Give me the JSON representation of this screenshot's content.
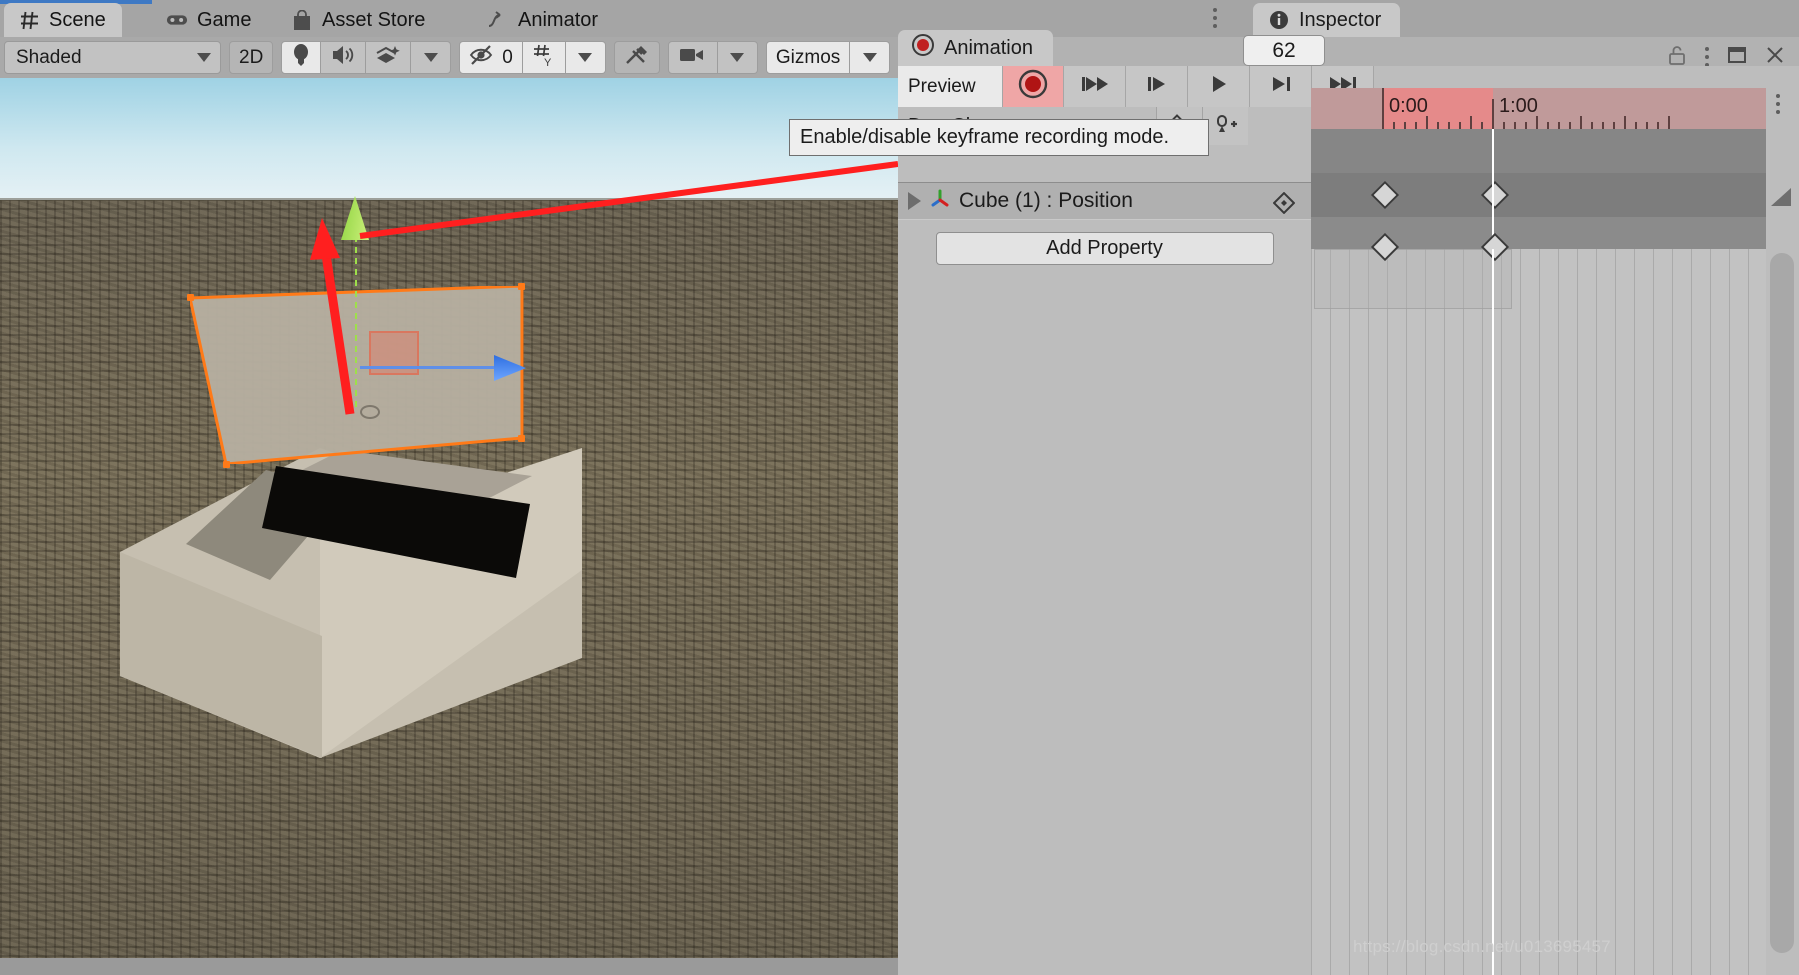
{
  "window": {
    "tabs": [
      {
        "label": "Scene",
        "icon": "grid-icon",
        "active": true
      },
      {
        "label": "Game",
        "icon": "gamepad-icon",
        "active": false
      },
      {
        "label": "Asset Store",
        "icon": "store-bag-icon",
        "active": false
      },
      {
        "label": "Animator",
        "icon": "animator-icon",
        "active": false
      }
    ],
    "inspector_tab": {
      "label": "Inspector",
      "icon": "info-icon"
    },
    "controls": {
      "lock": "lock-open-icon",
      "menu": "kebab-menu-icon",
      "maximize": "maximize-icon",
      "close": "close-icon"
    }
  },
  "scene_toolbar": {
    "draw_mode": "Shaded",
    "two_d": "2D",
    "lighting_icon": "lightbulb-icon",
    "audio_icon": "speaker-icon",
    "fx_icon": "effects-icon",
    "hidden_count": "0",
    "hidden_icon": "eye-off-icon",
    "grid_icon": "grid-snap-icon",
    "tools_icon": "tools-icon",
    "camera_icon": "camera-icon",
    "gizmos": "Gizmos"
  },
  "animation": {
    "tab_label": "Animation",
    "tab_icon": "record-circle-icon",
    "preview_label": "Preview",
    "record_icon": "record-button-icon",
    "transport": [
      {
        "name": "first-frame-button",
        "icon": "skip-start-icon"
      },
      {
        "name": "prev-keyframe-button",
        "icon": "step-back-icon"
      },
      {
        "name": "play-button",
        "icon": "play-icon"
      },
      {
        "name": "next-keyframe-button",
        "icon": "step-forward-icon"
      },
      {
        "name": "last-frame-button",
        "icon": "skip-end-icon"
      }
    ],
    "frame_value": "62",
    "clip_name": "DoorClose",
    "add_keyframe_icon": "add-keyframe-icon",
    "add_event_icon": "add-event-icon",
    "property_row": {
      "label": "Cube (1) : Position",
      "icon": "transform-axis-icon",
      "expander": "expand-triangle-icon",
      "keyframe_icon": "keyframe-diamond-icon"
    },
    "add_property_label": "Add Property",
    "timeline": {
      "ticks": [
        "0:00",
        "1:00"
      ],
      "keyframes_seconds": [
        0.0,
        1.0
      ]
    }
  },
  "tooltip": {
    "text": "Enable/disable keyframe recording mode."
  },
  "watermark": {
    "text": "https://blog.csdn.net/u013695457"
  },
  "colors": {
    "accent_blue": "#3e79c4",
    "record_red": "#c02020",
    "selection_orange": "#ff7a18",
    "annotation_red": "#ff1f1f",
    "timeline_red": "#e58a8a"
  }
}
